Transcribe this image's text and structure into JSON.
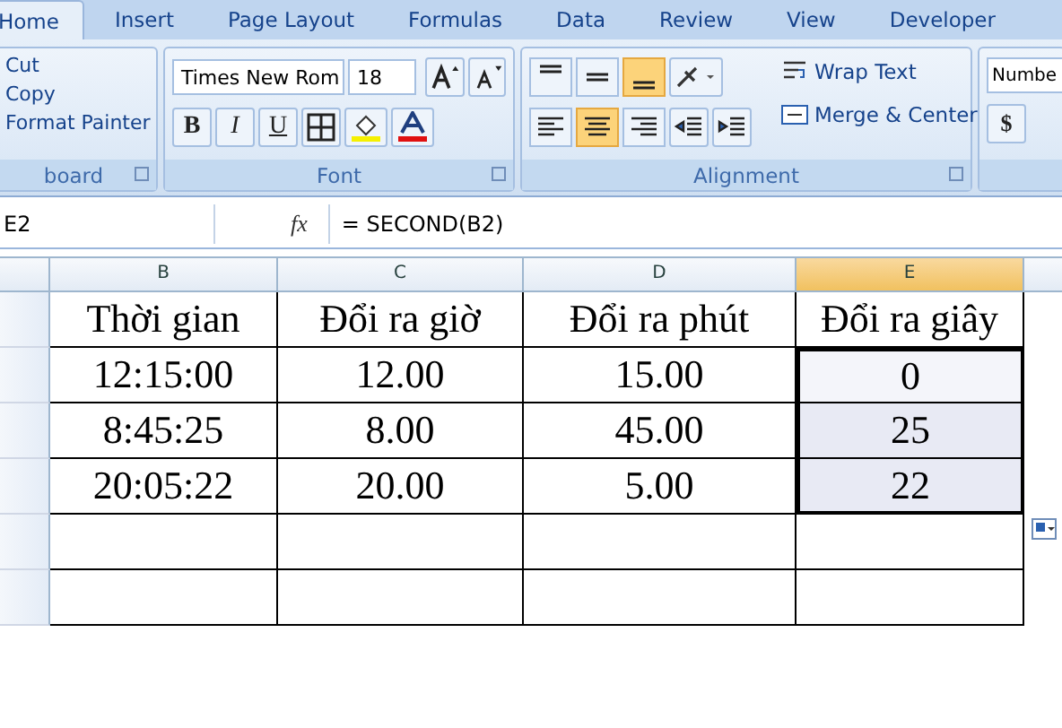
{
  "tabs": [
    {
      "label": "Home",
      "selected": true
    },
    {
      "label": "Insert",
      "selected": false
    },
    {
      "label": "Page Layout",
      "selected": false
    },
    {
      "label": "Formulas",
      "selected": false
    },
    {
      "label": "Data",
      "selected": false
    },
    {
      "label": "Review",
      "selected": false
    },
    {
      "label": "View",
      "selected": false
    },
    {
      "label": "Developer",
      "selected": false
    }
  ],
  "clipboard": {
    "items": [
      "Cut",
      "Copy",
      "Format Painter"
    ],
    "label": "board"
  },
  "font": {
    "name": "Times New Rom",
    "size": "18",
    "styles": [
      {
        "glyph": "B",
        "kind": "bold"
      },
      {
        "glyph": "I",
        "kind": "italic"
      },
      {
        "glyph": "U",
        "kind": "underline"
      }
    ],
    "label": "Font"
  },
  "alignment": {
    "vertical": [
      {
        "kind": "top",
        "selected": false
      },
      {
        "kind": "middle",
        "selected": false
      },
      {
        "kind": "bottom",
        "selected": true
      }
    ],
    "horizontal": [
      {
        "kind": "left",
        "selected": false
      },
      {
        "kind": "center",
        "selected": true
      },
      {
        "kind": "right",
        "selected": false
      }
    ],
    "wrap": "Wrap Text",
    "merge": "Merge & Center",
    "label": "Alignment"
  },
  "number": {
    "format": "Numbe",
    "currency": "$"
  },
  "formula_bar": {
    "name_box": "E2",
    "fx": "fx",
    "formula": "= SECOND(B2)"
  },
  "columns": [
    {
      "label": "B",
      "selected": false
    },
    {
      "label": "C",
      "selected": false
    },
    {
      "label": "D",
      "selected": false
    },
    {
      "label": "E",
      "selected": true
    }
  ],
  "rows": [
    {
      "cells": [
        {
          "text": "Thời gian",
          "selected": false
        },
        {
          "text": "Đổi ra giờ",
          "selected": false
        },
        {
          "text": "Đổi ra phút",
          "selected": false
        },
        {
          "text": "Đổi ra giây",
          "selected": false
        }
      ]
    },
    {
      "cells": [
        {
          "text": "12:15:00",
          "selected": false
        },
        {
          "text": "12.00",
          "selected": false
        },
        {
          "text": "15.00",
          "selected": false
        },
        {
          "text": "0",
          "selected": true
        }
      ]
    },
    {
      "cells": [
        {
          "text": "8:45:25",
          "selected": false
        },
        {
          "text": "8.00",
          "selected": false
        },
        {
          "text": "45.00",
          "selected": false
        },
        {
          "text": "25",
          "selected": true
        }
      ]
    },
    {
      "cells": [
        {
          "text": "20:05:22",
          "selected": false
        },
        {
          "text": "20.00",
          "selected": false
        },
        {
          "text": "5.00",
          "selected": false
        },
        {
          "text": "22",
          "selected": true
        }
      ]
    }
  ]
}
